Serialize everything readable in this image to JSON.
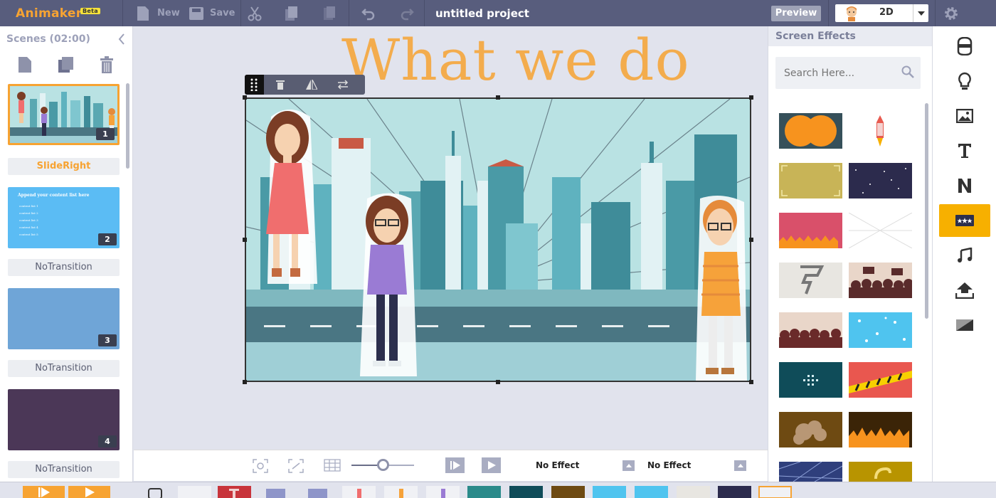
{
  "app": {
    "name": "Animaker",
    "badge": "Beta"
  },
  "toolbar": {
    "new_label": "New",
    "save_label": "Save",
    "project_title": "untitled project",
    "preview_label": "Preview",
    "mode_label": "2D"
  },
  "scenes": {
    "header": "Scenes (02:00)",
    "items": [
      {
        "number": "1",
        "transition": "SlideRight",
        "bg": "#5c7f8e",
        "selected": true
      },
      {
        "number": "2",
        "transition": "NoTransition",
        "bg": "#5bbcf4",
        "title": "Append your content list here",
        "bullets": [
          "content list 1",
          "content list 2",
          "content list 3",
          "content list 4",
          "content list 5"
        ]
      },
      {
        "number": "3",
        "transition": "NoTransition",
        "bg": "#6fa5d7"
      },
      {
        "number": "4",
        "transition": "NoTransition",
        "bg": "#4b3757"
      }
    ]
  },
  "canvas": {
    "title_text": "What we do"
  },
  "bottom": {
    "effect1": "No Effect",
    "effect2": "No Effect",
    "zoom_fraction": 0.5
  },
  "effects_panel": {
    "title": "Screen Effects",
    "search_placeholder": "Search Here..."
  },
  "colors": {
    "accent": "#f7a332",
    "toolbar": "#585d7d",
    "active_icon": "#f7b000"
  }
}
